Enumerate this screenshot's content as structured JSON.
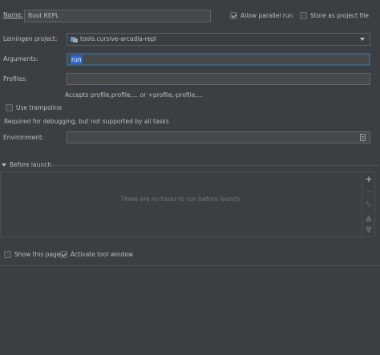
{
  "name": {
    "label": "Name:",
    "value": "Boot REPL"
  },
  "allow_parallel": {
    "label": "Allow parallel run",
    "checked": true
  },
  "store_project": {
    "label": "Store as project file",
    "checked": false
  },
  "project": {
    "label": "Leiningen project:",
    "value": "tools.cursive-arcadia-repl",
    "icon": "module-icon"
  },
  "arguments": {
    "label": "Arguments:",
    "value": "run"
  },
  "profiles": {
    "label": "Profiles:",
    "value": "",
    "hint": "Accepts profile,profile,... or +profile,-profile,..."
  },
  "trampoline": {
    "label": "Use trampoline",
    "checked": false,
    "note": "Required for debugging, but not supported by all tasks"
  },
  "environment": {
    "label": "Environment:",
    "value": ""
  },
  "before_launch": {
    "label": "Before launch",
    "empty_text": "There are no tasks to run before launch"
  },
  "show_page": {
    "label": "Show this page",
    "checked": false
  },
  "activate_tool": {
    "label": "Activate tool window",
    "checked": true
  },
  "colors": {
    "background": "#3c3f41",
    "field": "#45494a",
    "focus": "#3d6185",
    "selection": "#2f65ca"
  }
}
